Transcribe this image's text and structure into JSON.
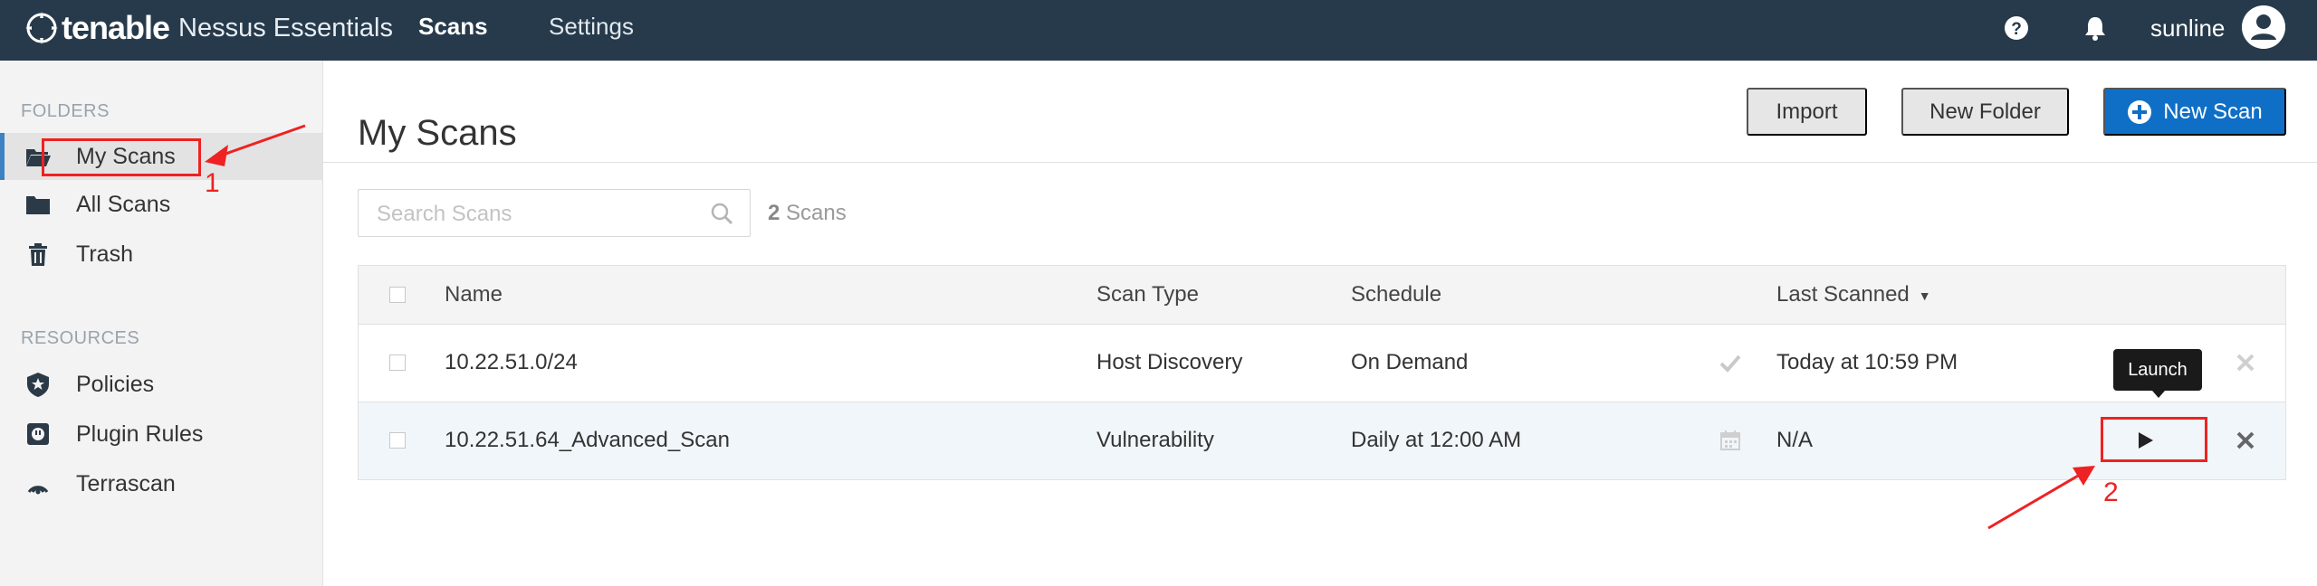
{
  "app": {
    "brand": "tenable",
    "product": "Nessus Essentials"
  },
  "nav": {
    "tabs": [
      {
        "label": "Scans",
        "active": true
      },
      {
        "label": "Settings",
        "active": false
      }
    ],
    "help_icon": "question-circle-icon",
    "notifications_icon": "bell-icon",
    "username": "sunline",
    "avatar_icon": "user-avatar-icon"
  },
  "sidebar": {
    "folders_heading": "FOLDERS",
    "folders": [
      {
        "label": "My Scans",
        "icon": "folder-open-icon",
        "active": true
      },
      {
        "label": "All Scans",
        "icon": "folder-icon",
        "active": false
      },
      {
        "label": "Trash",
        "icon": "trash-icon",
        "active": false
      }
    ],
    "resources_heading": "RESOURCES",
    "resources": [
      {
        "label": "Policies",
        "icon": "shield-star-icon"
      },
      {
        "label": "Plugin Rules",
        "icon": "plugin-icon"
      },
      {
        "label": "Terrascan",
        "icon": "terrascan-icon"
      }
    ]
  },
  "main": {
    "title": "My Scans",
    "buttons": {
      "import": "Import",
      "new_folder": "New Folder",
      "new_scan": "New Scan"
    },
    "search": {
      "placeholder": "Search Scans",
      "value": ""
    },
    "scan_count": {
      "number": "2",
      "label": "Scans"
    }
  },
  "table": {
    "columns": {
      "name": "Name",
      "scan_type": "Scan Type",
      "schedule": "Schedule",
      "last_scanned": "Last Scanned"
    },
    "sort": {
      "column": "last_scanned",
      "direction": "descending"
    },
    "rows": [
      {
        "name": "10.22.51.0/24",
        "scan_type": "Host Discovery",
        "schedule": "On Demand",
        "status_icon": "checkmark-icon",
        "last_scanned": "Today at 10:59 PM",
        "delete_icon": "close-icon"
      },
      {
        "name": "10.22.51.64_Advanced_Scan",
        "scan_type": "Vulnerability",
        "schedule": "Daily at 12:00 AM",
        "status_icon": "calendar-icon",
        "last_scanned": "N/A",
        "launch_icon": "play-icon",
        "delete_icon": "close-icon"
      }
    ]
  },
  "tooltip": {
    "text": "Launch"
  },
  "annotations": {
    "step1": "1",
    "step2": "2",
    "color": "#ee2222"
  },
  "colors": {
    "topbar": "#263a4b",
    "primary_button": "#0f6fc6",
    "sidebar_active_bar": "#3b82c4"
  }
}
